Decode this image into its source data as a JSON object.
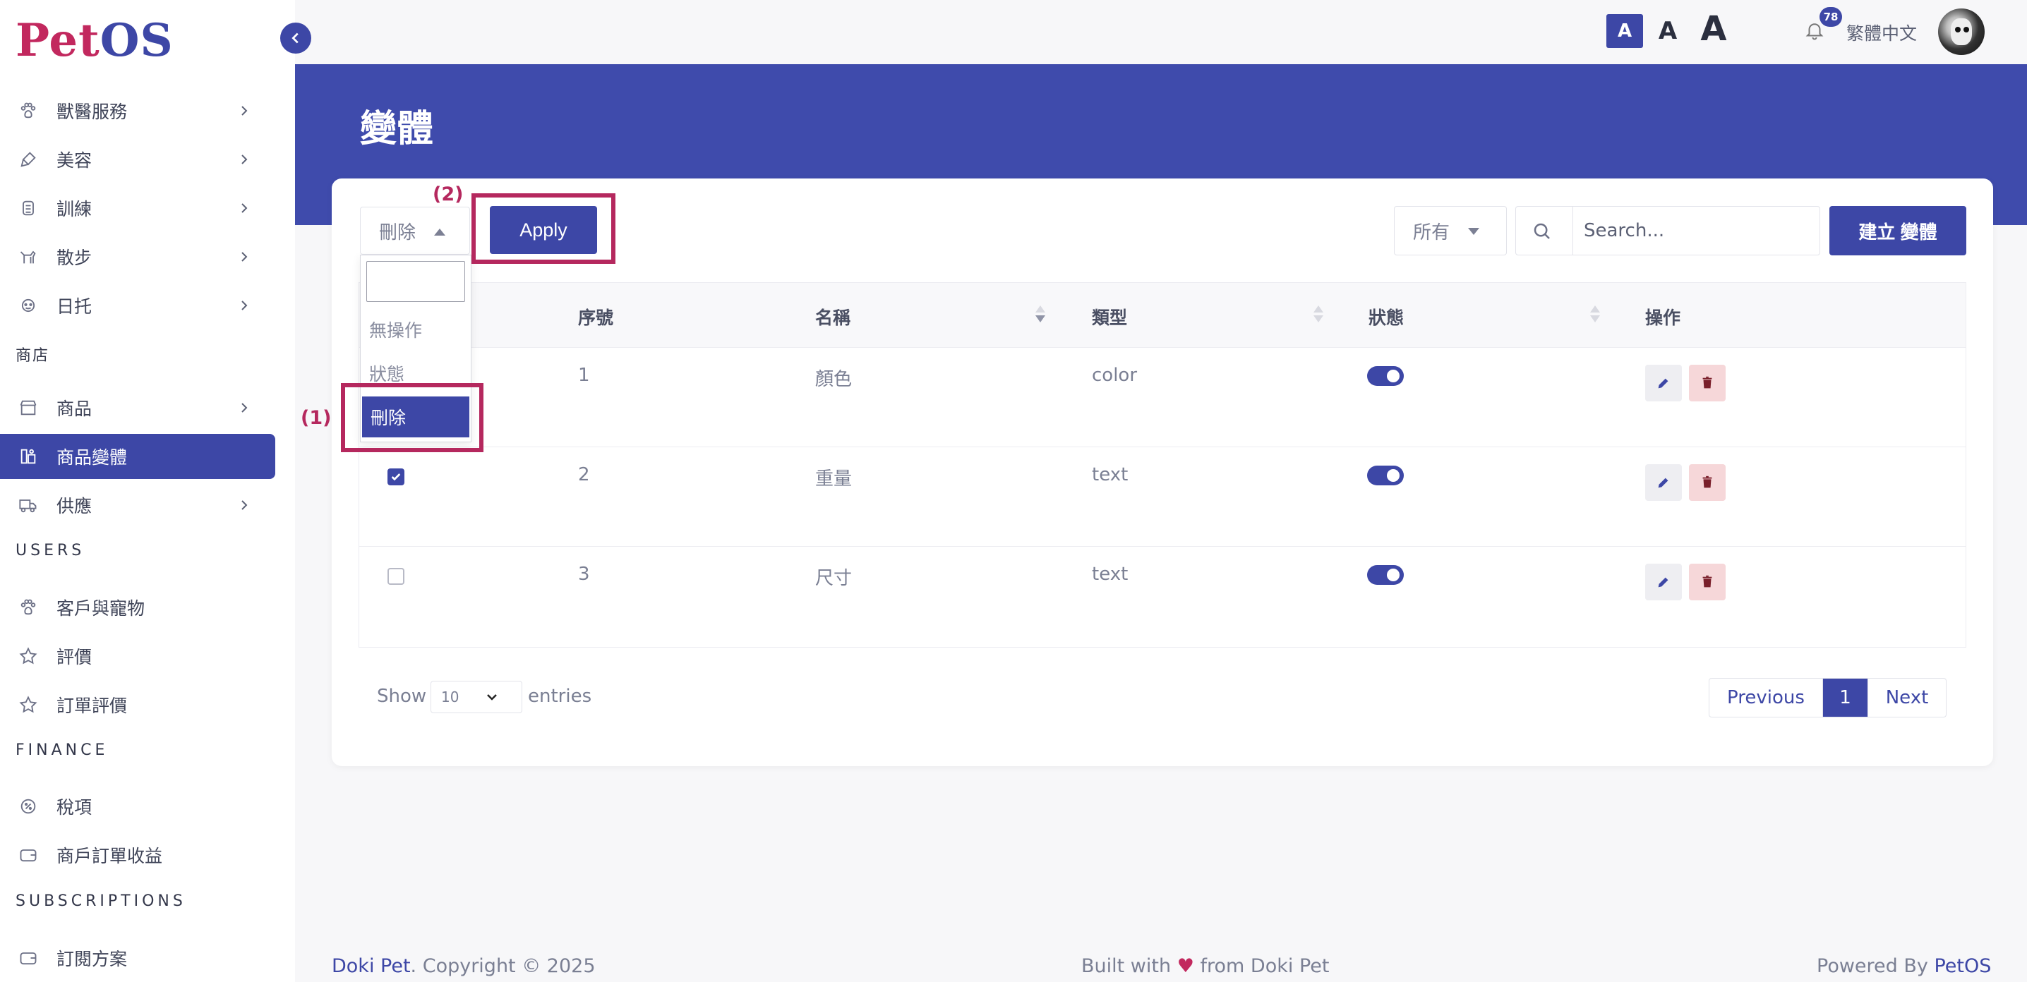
{
  "logo": {
    "part1": "Pet",
    "part2": "OS"
  },
  "sidebar": {
    "items": [
      {
        "label": "獸醫服務",
        "icon": "paw-icon",
        "chevron": true
      },
      {
        "label": "美容",
        "icon": "brush-icon",
        "chevron": true
      },
      {
        "label": "訓練",
        "icon": "treat-icon",
        "chevron": true
      },
      {
        "label": "散步",
        "icon": "dog-walk-icon",
        "chevron": true
      },
      {
        "label": "日托",
        "icon": "daycare-icon",
        "chevron": true
      }
    ],
    "shop_section": "商店",
    "shop_items": [
      {
        "label": "商品",
        "icon": "store-icon",
        "chevron": true
      },
      {
        "label": "商品變體",
        "icon": "variant-icon",
        "active": true
      },
      {
        "label": "供應",
        "icon": "truck-icon",
        "chevron": true
      }
    ],
    "users_section": "USERS",
    "users_items": [
      {
        "label": "客戶與寵物",
        "icon": "paw-icon"
      },
      {
        "label": "評價",
        "icon": "star-icon"
      },
      {
        "label": "訂單評價",
        "icon": "star-icon"
      }
    ],
    "finance_section": "FINANCE",
    "finance_items": [
      {
        "label": "稅項",
        "icon": "tax-icon"
      },
      {
        "label": "商戶訂單收益",
        "icon": "wallet-icon"
      }
    ],
    "subscriptions_section": "SUBSCRIPTIONS",
    "subscriptions_items": [
      {
        "label": "訂閱方案",
        "icon": "wallet-icon"
      }
    ]
  },
  "topbar": {
    "font_small": "A",
    "font_medium": "A",
    "font_large": "A",
    "notification_count": "78",
    "language": "繁體中文"
  },
  "page": {
    "title": "變體"
  },
  "toolbar": {
    "bulk_action_value": "刪除",
    "apply_label": "Apply",
    "filter_value": "所有",
    "search_placeholder": "Search...",
    "create_label": "建立 變體"
  },
  "dropdown": {
    "options": [
      "無操作",
      "狀態",
      "刪除"
    ],
    "selected": "刪除"
  },
  "annotations": {
    "step1": "(1)",
    "step2": "(2)"
  },
  "table": {
    "headers": [
      "序號",
      "名稱",
      "類型",
      "狀態",
      "操作"
    ],
    "rows": [
      {
        "id": "1",
        "name": "顏色",
        "type": "color",
        "status_on": true,
        "checked": false
      },
      {
        "id": "2",
        "name": "重量",
        "type": "text",
        "status_on": true,
        "checked": true
      },
      {
        "id": "3",
        "name": "尺寸",
        "type": "text",
        "status_on": true,
        "checked": false
      }
    ]
  },
  "pagination": {
    "show_label": "Show",
    "entries_value": "10",
    "entries_label": "entries",
    "previous": "Previous",
    "current": "1",
    "next": "Next"
  },
  "footer": {
    "brand": "Doki Pet",
    "copyright": ". Copyright © 2025",
    "built_prefix": "Built with",
    "heart": "♥",
    "built_suffix": "from Doki Pet",
    "powered_prefix": "Powered By",
    "powered_brand": "PetOS"
  },
  "colors": {
    "primary": "#3d47a6",
    "brand_red": "#c2285e",
    "highlight": "#b5285e"
  }
}
